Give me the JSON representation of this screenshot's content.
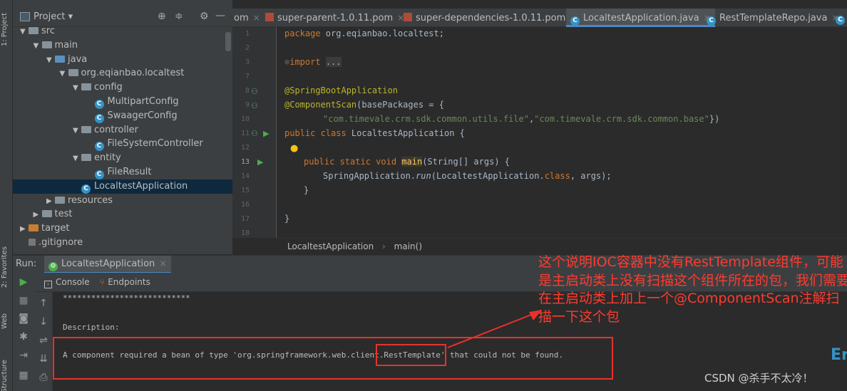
{
  "left_strip": {
    "project_label": "1: Project",
    "favorites_label": "2: Favorites",
    "web_label": "Web",
    "structure_label": "Structure"
  },
  "project_panel": {
    "title": "Project",
    "tree": [
      {
        "label": "src",
        "depth": 1,
        "expanded": true,
        "kind": "folder"
      },
      {
        "label": "main",
        "depth": 2,
        "expanded": true,
        "kind": "folder"
      },
      {
        "label": "java",
        "depth": 3,
        "expanded": true,
        "kind": "folder-blue"
      },
      {
        "label": "org.eqianbao.localtest",
        "depth": 4,
        "expanded": true,
        "kind": "package"
      },
      {
        "label": "config",
        "depth": 5,
        "expanded": true,
        "kind": "package"
      },
      {
        "label": "MultipartConfig",
        "depth": 6,
        "kind": "class"
      },
      {
        "label": "SwaagerConfig",
        "depth": 6,
        "kind": "class"
      },
      {
        "label": "controller",
        "depth": 5,
        "expanded": true,
        "kind": "package"
      },
      {
        "label": "FileSystemController",
        "depth": 6,
        "kind": "class"
      },
      {
        "label": "entity",
        "depth": 5,
        "expanded": true,
        "kind": "package"
      },
      {
        "label": "FileResult",
        "depth": 6,
        "kind": "class"
      },
      {
        "label": "LocaltestApplication",
        "depth": 5,
        "kind": "class-boot",
        "selected": true
      },
      {
        "label": "resources",
        "depth": 3,
        "expanded": false,
        "kind": "folder"
      },
      {
        "label": "test",
        "depth": 2,
        "expanded": false,
        "kind": "folder"
      },
      {
        "label": "target",
        "depth": 1,
        "expanded": false,
        "kind": "folder-orange"
      },
      {
        "label": ".gitignore",
        "depth": 1,
        "kind": "file"
      }
    ]
  },
  "tabs": [
    {
      "label": "om",
      "active": false
    },
    {
      "label": "super-parent-1.0.11.pom",
      "active": false
    },
    {
      "label": "super-dependencies-1.0.11.pom",
      "active": false
    },
    {
      "label": "LocaltestApplication.java",
      "active": true
    },
    {
      "label": "RestTemplateRepo.java",
      "active": false
    }
  ],
  "editor": {
    "line_numbers": [
      "1",
      "2",
      "3",
      "7",
      "8",
      "9",
      "10",
      "11",
      "12",
      "13",
      "14",
      "15",
      "16",
      "17",
      "18"
    ],
    "lines": {
      "l1_kw": "package ",
      "l1_rest": "org.eqianbao.localtest;",
      "l3_kw": "import ",
      "l3_rest": "...",
      "l8": "@SpringBootApplication",
      "l9_ann": "@ComponentScan",
      "l9_rest": "(basePackages = {",
      "l10_str1": "\"com.timevale.crm.sdk.common.utils.file\"",
      "l10_sep": ",",
      "l10_str2": "\"com.timevale.crm.sdk.common.base\"",
      "l10_end": "})",
      "l11_kw": "public class ",
      "l11_rest": "LocaltestApplication {",
      "l13_kw": "public static void ",
      "l13_fn": "main",
      "l13_rest": "(String[] args) {",
      "l14_a": "SpringApplication.",
      "l14_run": "run",
      "l14_b": "(LocaltestApplication.",
      "l14_kw": "class",
      "l14_c": ", args);",
      "l15": "}",
      "l17": "}"
    },
    "breadcrumb": [
      "LocaltestApplication",
      "main()"
    ]
  },
  "run_panel": {
    "label": "Run:",
    "config_name": "LocaltestApplication",
    "console_tab": "Console",
    "endpoints_tab": "Endpoints",
    "stars": "***************************",
    "description_label": "Description:",
    "error_prefix": "A component required a bean of type 'org.springframework.web.client.",
    "error_class": "RestTemplate'",
    "error_suffix": " that could not be found."
  },
  "annotation": {
    "text": "这个说明IOC容器中没有RestTemplate组件，可能是主启动类上没有扫描这个组件所在的包，我们需要在主启动类上加上一个@ComponentScan注解扫描一下这个包",
    "color": "#ff3b2f"
  },
  "watermark": "CSDN @杀手不太冷！",
  "corner_glyph": "Er"
}
